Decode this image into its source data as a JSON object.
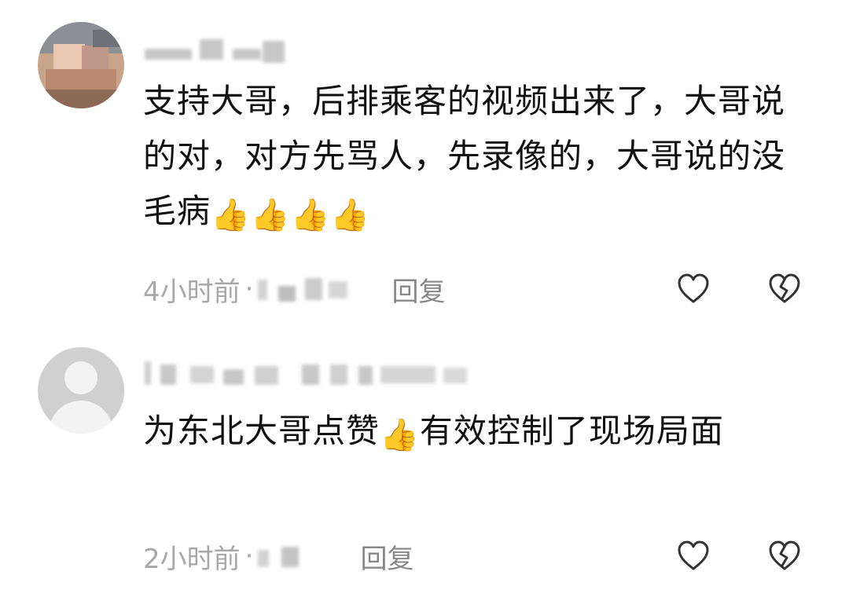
{
  "comments": [
    {
      "content": "支持大哥，后排乘客的视频出来了，大哥说的对，对方先骂人，先录像的，大哥说的没毛病",
      "emoji": "👍👍👍👍",
      "time": "4小时前",
      "separator": "·",
      "reply_label": "回复",
      "like_icon": "heart-outline-icon",
      "dislike_icon": "broken-heart-icon"
    },
    {
      "content_before": "为东北大哥点赞",
      "emoji": "👍",
      "content_after": "有效控制了现场局面",
      "time": "2小时前",
      "separator": "·",
      "reply_label": "回复",
      "like_icon": "heart-outline-icon",
      "dislike_icon": "broken-heart-icon"
    }
  ],
  "colors": {
    "text": "#111111",
    "meta": "#a8a8a8",
    "reply": "#888888",
    "icon": "#333333",
    "background": "#ffffff"
  }
}
